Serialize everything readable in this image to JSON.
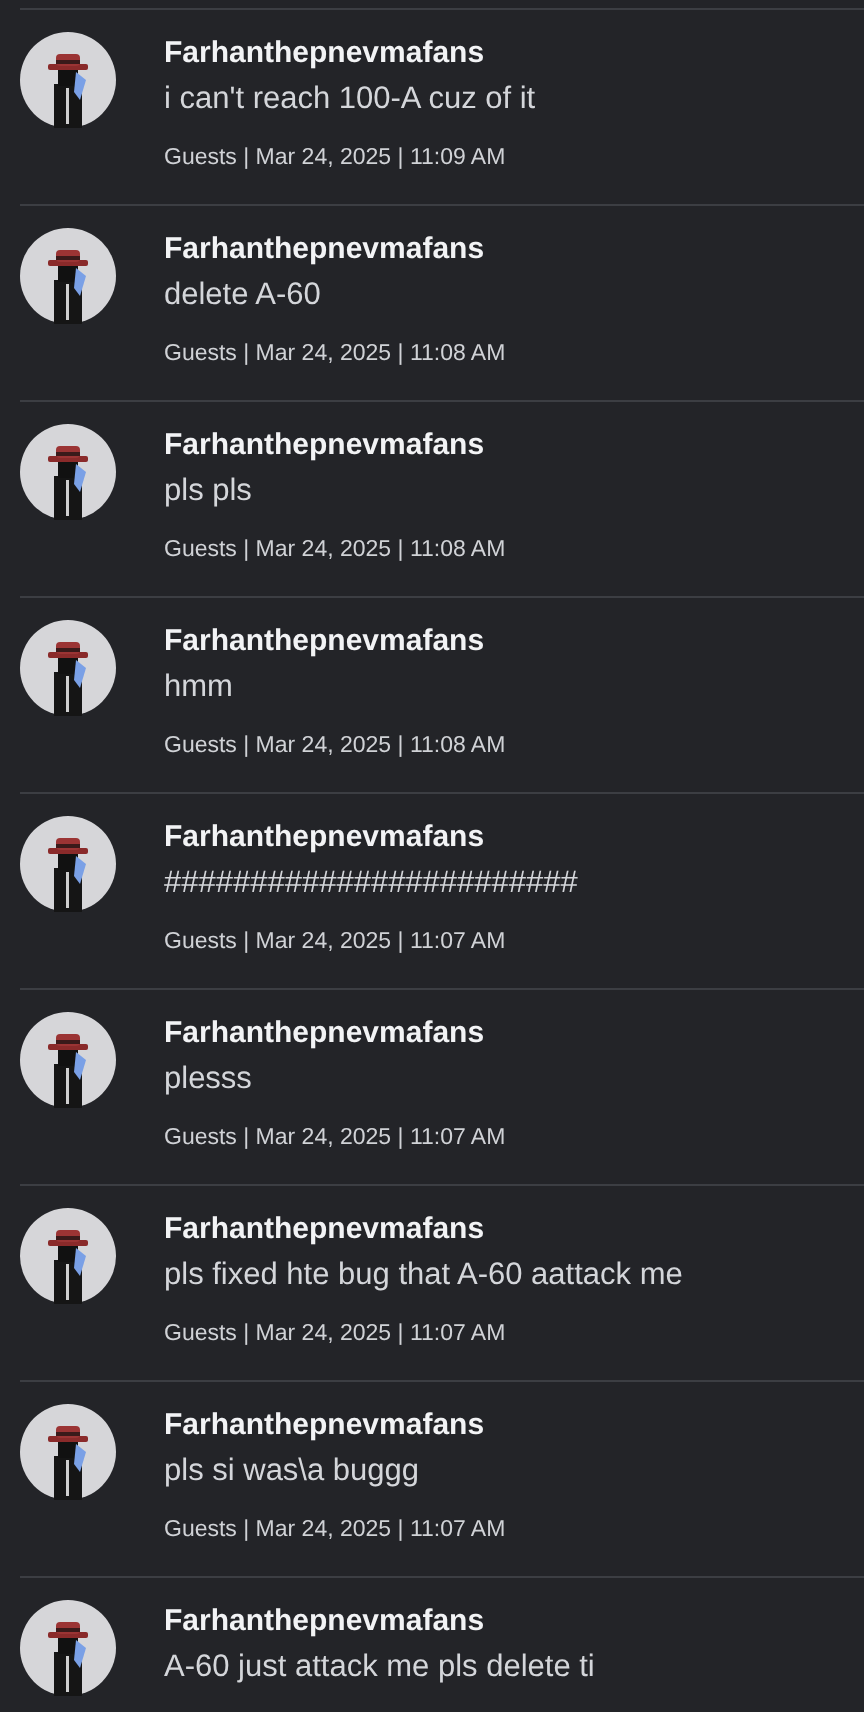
{
  "posts": [
    {
      "author": "Farhanthepnevmafans",
      "message": "i can't reach 100-A cuz of it",
      "meta": "Guests | Mar 24, 2025 | 11:09 AM"
    },
    {
      "author": "Farhanthepnevmafans",
      "message": "delete A-60",
      "meta": "Guests | Mar 24, 2025 | 11:08 AM"
    },
    {
      "author": "Farhanthepnevmafans",
      "message": "pls pls",
      "meta": "Guests | Mar 24, 2025 | 11:08 AM"
    },
    {
      "author": "Farhanthepnevmafans",
      "message": "hmm",
      "meta": "Guests | Mar 24, 2025 | 11:08 AM"
    },
    {
      "author": "Farhanthepnevmafans",
      "message": "########################",
      "meta": "Guests | Mar 24, 2025 | 11:07 AM"
    },
    {
      "author": "Farhanthepnevmafans",
      "message": "plesss",
      "meta": "Guests | Mar 24, 2025 | 11:07 AM"
    },
    {
      "author": "Farhanthepnevmafans",
      "message": "pls fixed hte bug that A-60 aattack me",
      "meta": "Guests | Mar 24, 2025 | 11:07 AM"
    },
    {
      "author": "Farhanthepnevmafans",
      "message": "pls si was\\a buggg",
      "meta": "Guests | Mar 24, 2025 | 11:07 AM"
    },
    {
      "author": "Farhanthepnevmafans",
      "message": "A-60 just attack me pls delete ti"
    }
  ]
}
